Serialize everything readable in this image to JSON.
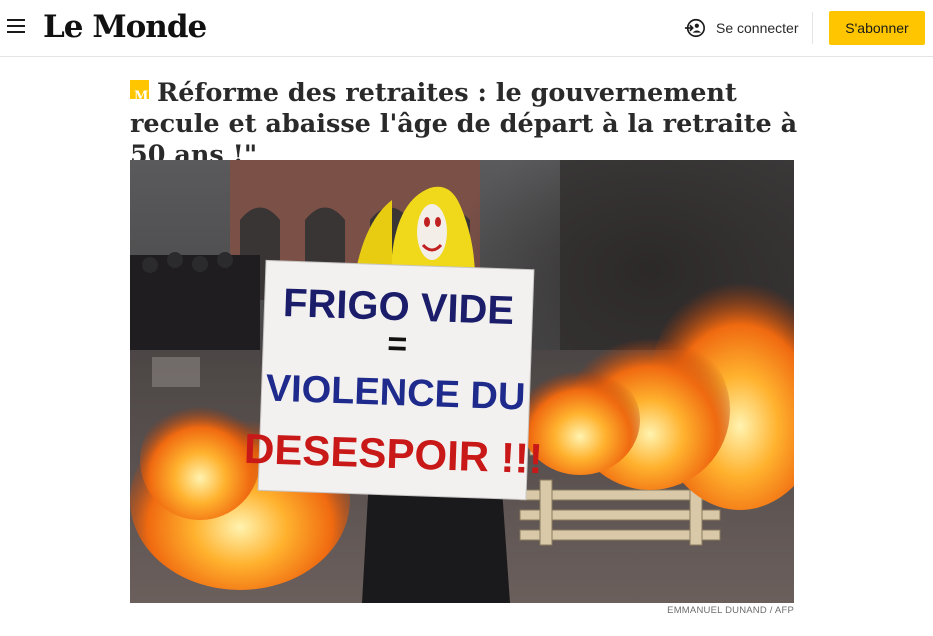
{
  "header": {
    "logo_text": "Le Monde",
    "login_label": "Se connecter",
    "subscribe_label": "S'abonner",
    "accent_color": "#ffc600"
  },
  "article": {
    "badge_icon": "le-monde-m-icon",
    "headline": "Réforme des retraites : le gouvernement recule et abaisse l'âge de départ à la retraite à 50 ans !\"",
    "image": {
      "description_icon": "protest-photo",
      "sign_lines": [
        "FRIGO VIDE",
        "=",
        "VIOLENCE DU",
        "DESESPOIR !!!"
      ]
    },
    "credit": "EMMANUEL DUNAND / AFP"
  }
}
